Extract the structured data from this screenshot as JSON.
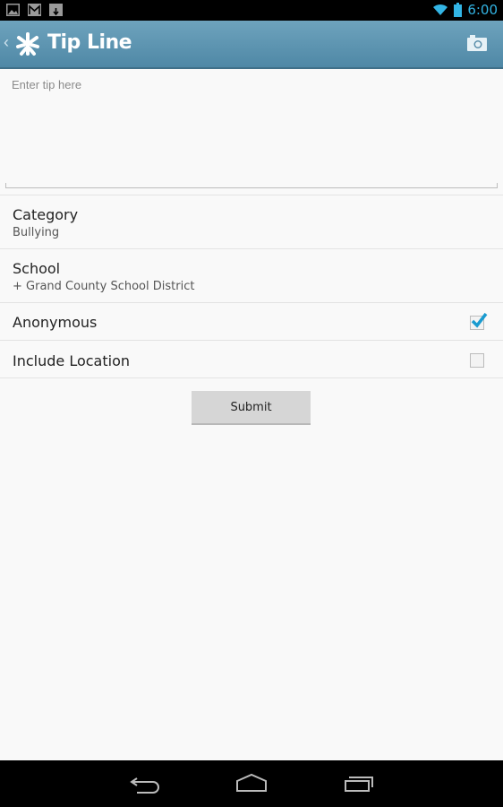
{
  "status_bar": {
    "left_icons": [
      "gallery-icon",
      "gmail-icon",
      "download-icon"
    ],
    "right_icons": [
      "wifi-icon",
      "battery-icon"
    ],
    "time": "6:00"
  },
  "action_bar": {
    "back_glyph": "‹",
    "title": "Tip Line",
    "accent_color": "#5a93b0",
    "action_icon": "camera-icon"
  },
  "tip": {
    "placeholder": "Enter tip here",
    "value": ""
  },
  "fields": {
    "category": {
      "label": "Category",
      "value": "Bullying"
    },
    "school": {
      "label": "School",
      "value": "+ Grand County School District"
    }
  },
  "options": {
    "anonymous": {
      "label": "Anonymous",
      "checked": true
    },
    "include_location": {
      "label": "Include Location",
      "checked": false
    }
  },
  "submit": {
    "label": "Submit"
  },
  "nav_bar": {
    "buttons": [
      "back",
      "home",
      "recent-apps"
    ]
  },
  "colors": {
    "check": "#1a9bd0"
  }
}
